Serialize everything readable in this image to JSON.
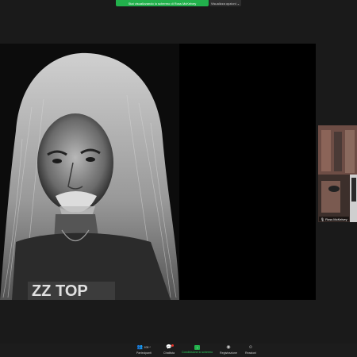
{
  "top_bar": {
    "share_status": "Stai visualizzando lo schermo di Ross McKelvey",
    "view_options": "Visualizza opzioni ⌄"
  },
  "photo": {
    "shirt_logo": "ZZ TOP"
  },
  "participant": {
    "name": "Ross McKelvey"
  },
  "toolbar": {
    "participants_label": "Partecipanti",
    "participants_count": "108",
    "chat_label": "Chatlista",
    "share_label": "Condivisione lo schermo",
    "record_label": "Registrazione",
    "reactions_label": "Reazioni"
  },
  "icons": [
    "participants-icon",
    "chat-icon",
    "share-screen-icon",
    "record-icon",
    "reactions-icon",
    "mic-icon"
  ],
  "colors": {
    "accent": "#22b14c",
    "background": "#1a1a1a",
    "badge": "#e5332a"
  }
}
